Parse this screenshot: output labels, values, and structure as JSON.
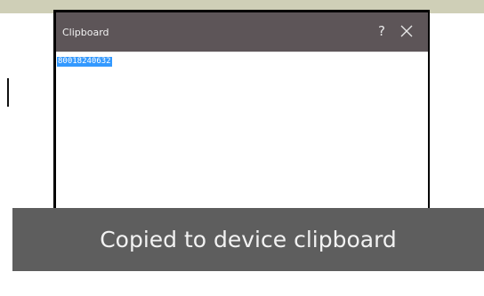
{
  "dialog": {
    "title": "Clipboard",
    "help_label": "?",
    "close_icon": "close-icon",
    "clipboard_text": "80018240632"
  },
  "toast": {
    "message": "Copied to device clipboard"
  },
  "colors": {
    "top_bar": "#cfcfb7",
    "dialog_header": "#5d5558",
    "selection": "#3399ff",
    "toast_background": "#5e5e5e"
  }
}
